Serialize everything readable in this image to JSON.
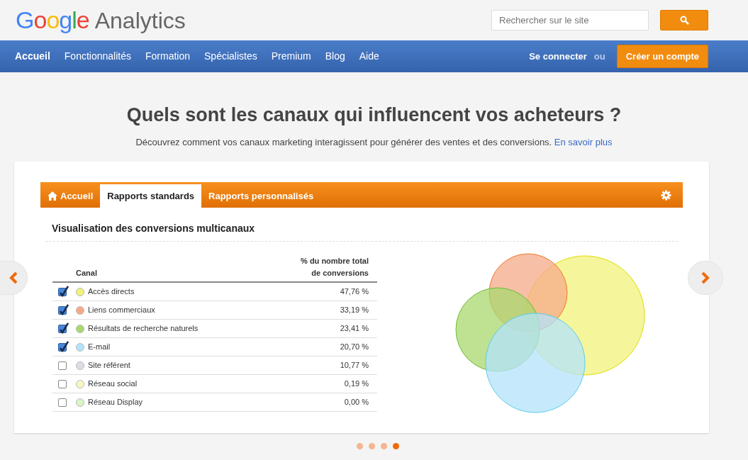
{
  "header": {
    "logo_brand": "Google",
    "logo_product": "Analytics",
    "search": {
      "placeholder": "Rechercher sur le site"
    }
  },
  "nav": {
    "items": [
      {
        "label": "Accueil",
        "selected": true
      },
      {
        "label": "Fonctionnalités",
        "selected": false
      },
      {
        "label": "Formation",
        "selected": false
      },
      {
        "label": "Spécialistes",
        "selected": false
      },
      {
        "label": "Premium",
        "selected": false
      },
      {
        "label": "Blog",
        "selected": false
      },
      {
        "label": "Aide",
        "selected": false
      }
    ],
    "signin": "Se connecter",
    "or": "ou",
    "signup": "Créer un compte"
  },
  "hero": {
    "title": "Quels sont les canaux qui influencent vos acheteurs ?",
    "subtitle": "Découvrez comment vos canaux marketing interagissent pour générer des ventes et des conversions.",
    "link": "En savoir plus"
  },
  "report": {
    "tabs": [
      {
        "label": "Accueil",
        "selected": false
      },
      {
        "label": "Rapports standards",
        "selected": true
      },
      {
        "label": "Rapports personnalisés",
        "selected": false
      }
    ],
    "title": "Visualisation des conversions multicanaux",
    "columns": [
      "Canal",
      "% du nombre total de conversions"
    ],
    "channels": [
      {
        "name": "Accès directs",
        "value": "47,76 %",
        "checked": true,
        "color": "#f2f27a"
      },
      {
        "name": "Liens commerciaux",
        "value": "33,19 %",
        "checked": true,
        "color": "#f5a98a"
      },
      {
        "name": "Résultats de recherche naturels",
        "value": "23,41 %",
        "checked": true,
        "color": "#a9d86e"
      },
      {
        "name": "E-mail",
        "value": "20,70 %",
        "checked": true,
        "color": "#b3e3fb"
      },
      {
        "name": "Site référent",
        "value": "10,77 %",
        "checked": false,
        "color": "#dcdde5"
      },
      {
        "name": "Réseau social",
        "value": "0,19 %",
        "checked": false,
        "color": "#f8f6c2"
      },
      {
        "name": "Réseau Display",
        "value": "0,00 %",
        "checked": false,
        "color": "#d9f5c6"
      }
    ]
  },
  "carousel": {
    "dots": [
      {
        "selected": false
      },
      {
        "selected": false
      },
      {
        "selected": false
      },
      {
        "selected": true
      }
    ]
  }
}
